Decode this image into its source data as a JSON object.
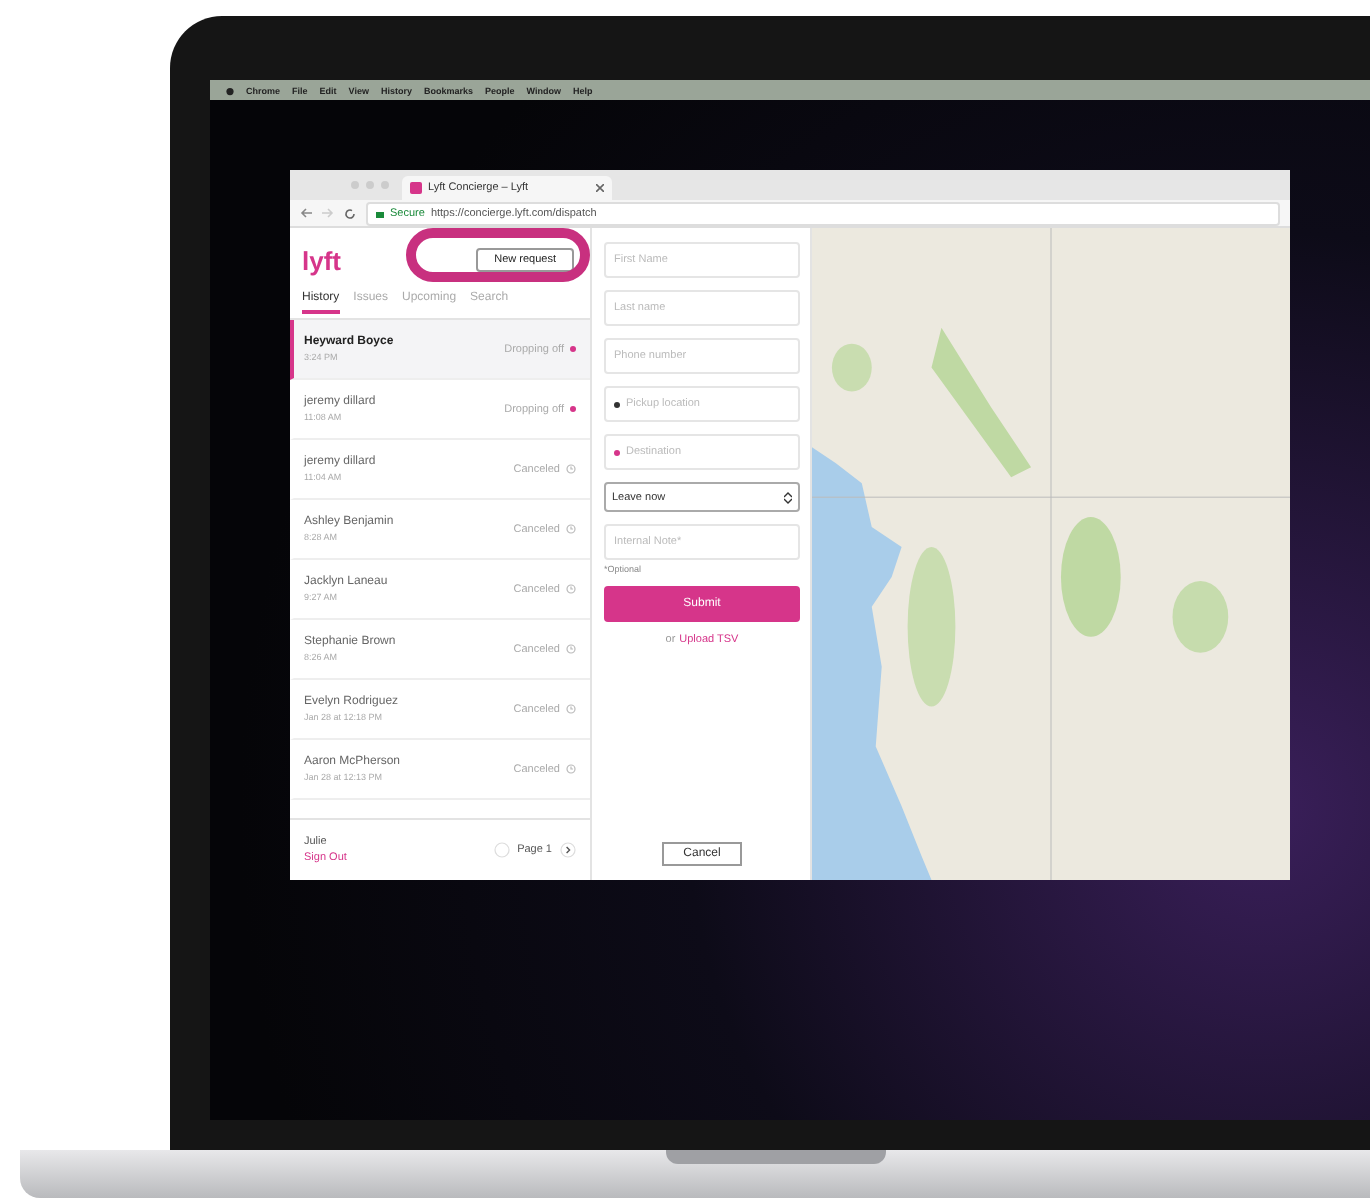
{
  "menu_bar": {
    "items": [
      "Chrome",
      "File",
      "Edit",
      "View",
      "History",
      "Bookmarks",
      "People",
      "Window",
      "Help"
    ]
  },
  "browser": {
    "tab_title": "Lyft Concierge – Lyft",
    "secure_label": "Secure",
    "url": "https://concierge.lyft.com/dispatch"
  },
  "sidebar": {
    "logo": "lyft",
    "new_request": "New request",
    "tabs": [
      {
        "label": "History",
        "selected": true
      },
      {
        "label": "Issues",
        "selected": false
      },
      {
        "label": "Upcoming",
        "selected": false
      },
      {
        "label": "Search",
        "selected": false
      }
    ],
    "rides": [
      {
        "name": "Heyward Boyce",
        "time": "3:24 PM",
        "status": "Dropping off",
        "kind": "active",
        "selected": true
      },
      {
        "name": "jeremy dillard",
        "time": "11:08 AM",
        "status": "Dropping off",
        "kind": "active",
        "selected": false
      },
      {
        "name": "jeremy dillard",
        "time": "11:04 AM",
        "status": "Canceled",
        "kind": "canceled",
        "selected": false
      },
      {
        "name": "Ashley Benjamin",
        "time": "8:28 AM",
        "status": "Canceled",
        "kind": "canceled",
        "selected": false
      },
      {
        "name": "Jacklyn Laneau",
        "time": "9:27 AM",
        "status": "Canceled",
        "kind": "canceled",
        "selected": false
      },
      {
        "name": "Stephanie Brown",
        "time": "8:26 AM",
        "status": "Canceled",
        "kind": "canceled",
        "selected": false
      },
      {
        "name": "Evelyn Rodriguez",
        "time": "Jan 28 at 12:18 PM",
        "status": "Canceled",
        "kind": "canceled",
        "selected": false
      },
      {
        "name": "Aaron McPherson",
        "time": "Jan 28 at 12:13 PM",
        "status": "Canceled",
        "kind": "canceled",
        "selected": false
      }
    ],
    "user": "Julie",
    "sign_out": "Sign Out",
    "page": "Page 1"
  },
  "form": {
    "fields": [
      {
        "placeholder": "First Name",
        "kind": "plain"
      },
      {
        "placeholder": "Last name",
        "kind": "plain"
      },
      {
        "placeholder": "Phone number",
        "kind": "plain"
      },
      {
        "placeholder": "Pickup location",
        "kind": "pickup"
      },
      {
        "placeholder": "Destination",
        "kind": "destination"
      }
    ],
    "when": "Leave now",
    "note": {
      "placeholder": "Internal Note*"
    },
    "optional": "*Optional",
    "submit": "Submit",
    "upload_prefix": "or",
    "upload_link": "Upload TSV",
    "cancel": "Cancel"
  }
}
